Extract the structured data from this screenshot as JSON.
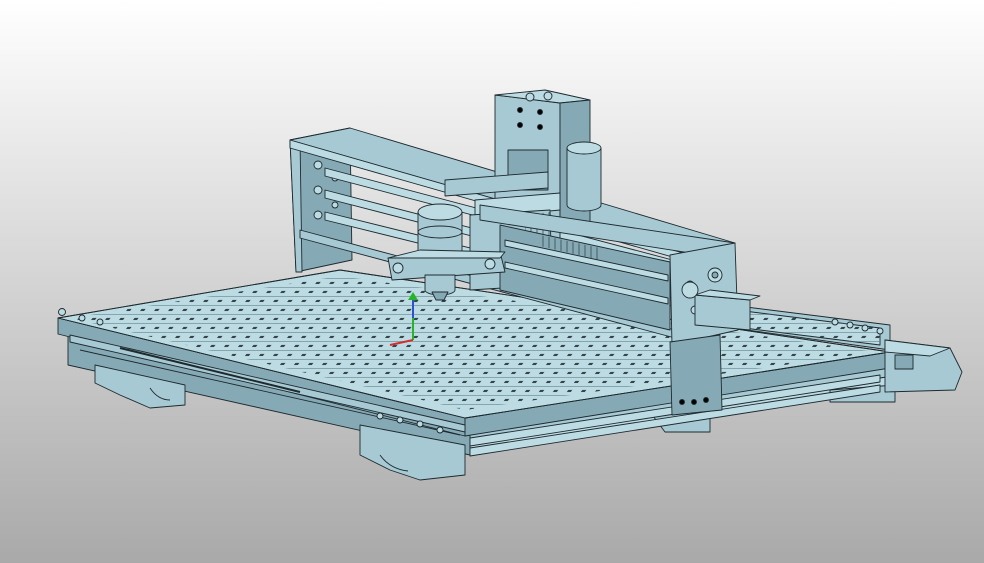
{
  "viewport": {
    "background_top": "#ffffff",
    "background_bottom": "#a9a9a9",
    "model_fill": "#a6c9d3",
    "model_fill_light": "#bcdbe3",
    "model_fill_dark": "#86aab5",
    "edge_color": "#1e2a2e"
  },
  "model": {
    "name": "cnc-router-assembly"
  },
  "triad": {
    "x_color": "#d23030",
    "y_color": "#28b428",
    "z_color": "#3050d0"
  }
}
